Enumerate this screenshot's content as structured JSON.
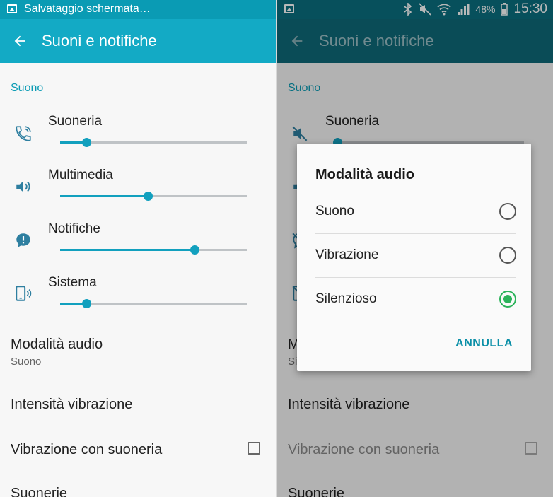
{
  "colors": {
    "accent": "#13aac5",
    "accent_dark": "#0a9bb4",
    "slider": "#12a0be",
    "radio_selected": "#2bb35a"
  },
  "left": {
    "status": {
      "notification_text": "Salvataggio schermata…"
    },
    "appbar": {
      "title": "Suoni e notifiche"
    },
    "section": "Suono",
    "sliders": [
      {
        "label": "Suoneria",
        "icon": "ringer-phone-icon",
        "level": 0.14
      },
      {
        "label": "Multimedia",
        "icon": "speaker-icon",
        "level": 0.47
      },
      {
        "label": "Notifiche",
        "icon": "notification-bubble-icon",
        "level": 0.72
      },
      {
        "label": "Sistema",
        "icon": "system-phone-icon",
        "level": 0.14
      }
    ],
    "audio_mode": {
      "title": "Modalità audio",
      "value": "Suono"
    },
    "vibration_intensity": "Intensità vibrazione",
    "vibrate_with_ringer": "Vibrazione con suoneria",
    "ringtones": "Suonerie"
  },
  "right": {
    "status": {
      "battery": "48%",
      "time": "15:30"
    },
    "appbar": {
      "title": "Suoni e notifiche"
    },
    "section": "Suono",
    "ringer_label": "Suoneria",
    "audio_mode_partial": "M",
    "audio_mode_sub_partial": "Si",
    "vibration_intensity": "Intensità vibrazione",
    "vibrate_with_ringer": "Vibrazione con suoneria",
    "ringtones": "Suonerie",
    "dialog": {
      "title": "Modalità audio",
      "options": [
        {
          "label": "Suono",
          "selected": false
        },
        {
          "label": "Vibrazione",
          "selected": false
        },
        {
          "label": "Silenzioso",
          "selected": true
        }
      ],
      "cancel": "ANNULLA"
    }
  }
}
